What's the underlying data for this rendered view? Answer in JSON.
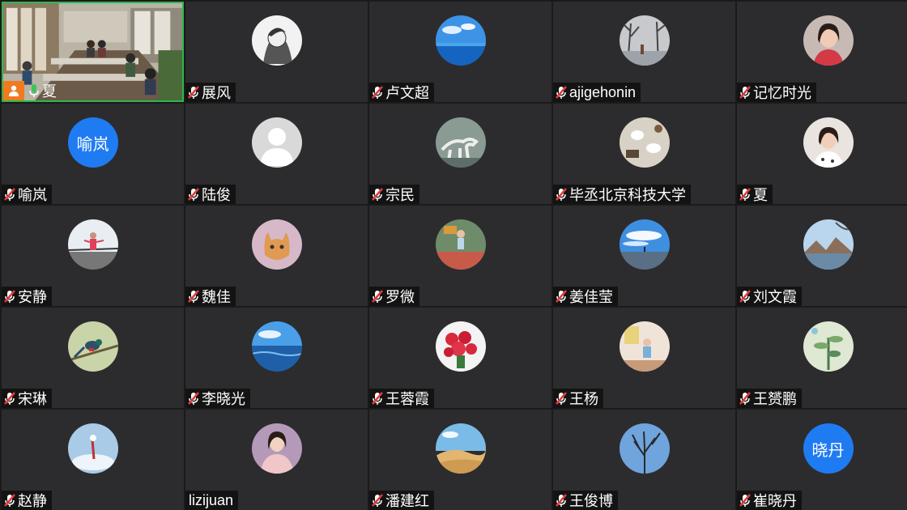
{
  "participants": [
    {
      "name": "夏",
      "self": true,
      "mic": "on",
      "avatar_type": "video"
    },
    {
      "name": "展风",
      "mic": "muted",
      "avatar_type": "photo",
      "avatar_icon": "anime-boy-photo"
    },
    {
      "name": "卢文超",
      "mic": "muted",
      "avatar_type": "photo",
      "avatar_icon": "ocean-sky-photo"
    },
    {
      "name": "ajigehonin",
      "mic": "muted",
      "avatar_type": "photo",
      "avatar_icon": "winter-street-photo"
    },
    {
      "name": "记忆时光",
      "mic": "muted",
      "avatar_type": "photo",
      "avatar_icon": "woman-portrait-photo"
    },
    {
      "name": "喻岚",
      "mic": "muted",
      "avatar_type": "text",
      "avatar_text": "喻岚"
    },
    {
      "name": "陆俊",
      "mic": "muted",
      "avatar_type": "photo",
      "avatar_icon": "default-user-photo"
    },
    {
      "name": "宗民",
      "mic": "muted",
      "avatar_type": "photo",
      "avatar_icon": "horse-painting-photo"
    },
    {
      "name": "毕丞北京科技大学",
      "mic": "muted",
      "avatar_type": "photo",
      "avatar_icon": "tea-table-photo"
    },
    {
      "name": "夏",
      "mic": "muted",
      "avatar_type": "photo",
      "avatar_icon": "woman-smiling-photo"
    },
    {
      "name": "安静",
      "mic": "muted",
      "avatar_type": "photo",
      "avatar_icon": "person-railing-photo"
    },
    {
      "name": "魏佳",
      "mic": "muted",
      "avatar_type": "photo",
      "avatar_icon": "cat-photo"
    },
    {
      "name": "罗微",
      "mic": "muted",
      "avatar_type": "photo",
      "avatar_icon": "child-playground-photo"
    },
    {
      "name": "姜佳莹",
      "mic": "muted",
      "avatar_type": "photo",
      "avatar_icon": "blue-sky-field-photo"
    },
    {
      "name": "刘文霞",
      "mic": "muted",
      "avatar_type": "photo",
      "avatar_icon": "mountain-lake-photo"
    },
    {
      "name": "宋琳",
      "mic": "muted",
      "avatar_type": "photo",
      "avatar_icon": "bird-branch-photo"
    },
    {
      "name": "李晓光",
      "mic": "muted",
      "avatar_type": "photo",
      "avatar_icon": "ocean-horizon-photo"
    },
    {
      "name": "王蓉霞",
      "mic": "muted",
      "avatar_type": "photo",
      "avatar_icon": "red-roses-photo"
    },
    {
      "name": "王杨",
      "mic": "muted",
      "avatar_type": "photo",
      "avatar_icon": "child-room-photo"
    },
    {
      "name": "王赟鹏",
      "mic": "muted",
      "avatar_type": "photo",
      "avatar_icon": "plant-illustration-photo"
    },
    {
      "name": "赵静",
      "mic": "muted",
      "avatar_type": "photo",
      "avatar_icon": "snow-sky-photo"
    },
    {
      "name": "lizijuan",
      "mic": "none",
      "avatar_type": "photo",
      "avatar_icon": "woman-pink-photo"
    },
    {
      "name": "潘建红",
      "mic": "muted",
      "avatar_type": "photo",
      "avatar_icon": "desert-dunes-photo"
    },
    {
      "name": "王俊博",
      "mic": "muted",
      "avatar_type": "photo",
      "avatar_icon": "bare-tree-photo"
    },
    {
      "name": "崔晓丹",
      "mic": "muted",
      "avatar_type": "text",
      "avatar_text": "晓丹"
    }
  ],
  "colors": {
    "tile_bg": "#2c2c2e",
    "self_border": "#2db84d",
    "text_avatar_bg": "#1f7bf2",
    "muted_mic": "#e23b3b",
    "active_mic": "#3fc35c",
    "self_badge": "#f07b1f"
  }
}
